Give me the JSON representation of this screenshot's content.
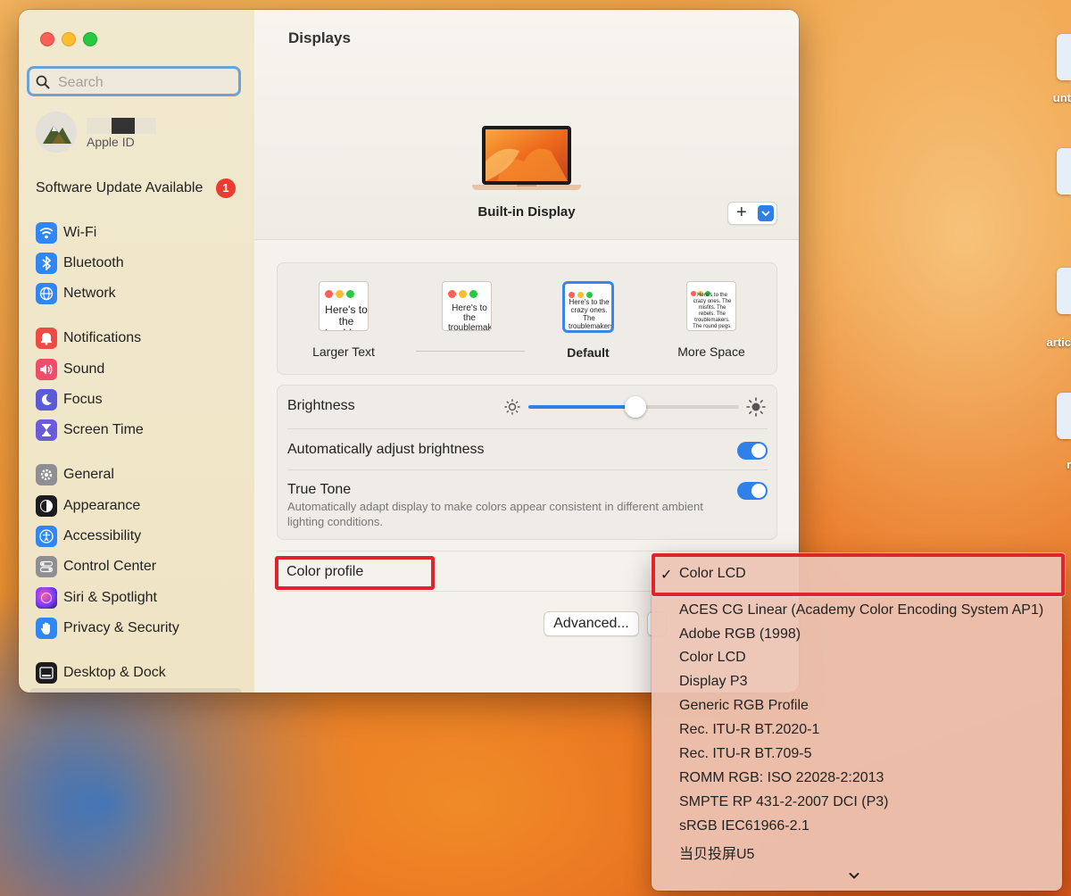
{
  "desktop": {
    "icon_labels": [
      "unt",
      "artic",
      "r"
    ]
  },
  "window": {
    "title": "Displays",
    "traffic": [
      "close",
      "minimize",
      "zoom"
    ]
  },
  "sidebar": {
    "search_placeholder": "Search",
    "account_sub": "Apple ID",
    "update_label": "Software Update Available",
    "update_badge": "1",
    "items": [
      {
        "label": "Wi-Fi",
        "icon": "wifi-icon",
        "color": "#2f86f5"
      },
      {
        "label": "Bluetooth",
        "icon": "bluetooth-icon",
        "color": "#2f86f5"
      },
      {
        "label": "Network",
        "icon": "globe-icon",
        "color": "#2f86f5"
      },
      {
        "label": "Notifications",
        "icon": "bell-icon",
        "color": "#ef4b44"
      },
      {
        "label": "Sound",
        "icon": "speaker-icon",
        "color": "#ef4b6a"
      },
      {
        "label": "Focus",
        "icon": "moon-icon",
        "color": "#5b5bd6"
      },
      {
        "label": "Screen Time",
        "icon": "hourglass-icon",
        "color": "#6a5bd6"
      },
      {
        "label": "General",
        "icon": "gear-icon",
        "color": "#8e8e93"
      },
      {
        "label": "Appearance",
        "icon": "appearance-icon",
        "color": "#1c1c1e"
      },
      {
        "label": "Accessibility",
        "icon": "accessibility-icon",
        "color": "#2f86f5"
      },
      {
        "label": "Control Center",
        "icon": "control-center-icon",
        "color": "#8e8e93"
      },
      {
        "label": "Siri & Spotlight",
        "icon": "siri-icon",
        "color": "#c83cdb"
      },
      {
        "label": "Privacy & Security",
        "icon": "hand-icon",
        "color": "#2f86f5"
      },
      {
        "label": "Desktop & Dock",
        "icon": "dock-icon",
        "color": "#1c1c1e"
      }
    ]
  },
  "display": {
    "name": "Built-in Display",
    "add_label": "+"
  },
  "resolution": {
    "options": [
      {
        "label": "Larger Text",
        "preview": "Here's to the troublemakers",
        "selected": false
      },
      {
        "label": "",
        "preview": "Here's to the troublemakers. The ones who see things",
        "selected": false
      },
      {
        "label": "Default",
        "preview": "Here's to the crazy ones. The troublemakers. The ones who see things differently. They're not fond of rules. And they",
        "selected": true
      },
      {
        "label": "More Space",
        "preview": "Here's to the crazy ones. The misfits. The rebels. The troublemakers. The round pegs. The ones who see things differently. They're not fond of rules. And they have no respect for the status quo. You can quote them, disagree with them. About the only thing you can't do is ignore them. Because they change things.",
        "selected": false
      }
    ]
  },
  "brightness": {
    "label": "Brightness",
    "level_fraction": 0.51,
    "auto_label": "Automatically adjust brightness",
    "auto_on": true,
    "truetone_label": "True Tone",
    "truetone_desc": "Automatically adapt display to make colors appear consistent in different ambient lighting conditions.",
    "truetone_on": true
  },
  "color_profile": {
    "label": "Color profile",
    "advanced_label": "Advanced...",
    "selected": "Color LCD",
    "options": [
      "ACES CG Linear (Academy Color Encoding System AP1)",
      "Adobe RGB (1998)",
      "Color LCD",
      "Display P3",
      "Generic RGB Profile",
      "Rec. ITU-R BT.2020-1",
      "Rec. ITU-R BT.709-5",
      "ROMM RGB: ISO 22028-2:2013",
      "SMPTE RP 431-2-2007 DCI (P3)",
      "sRGB IEC61966-2.1",
      "当贝投屏U5"
    ]
  }
}
